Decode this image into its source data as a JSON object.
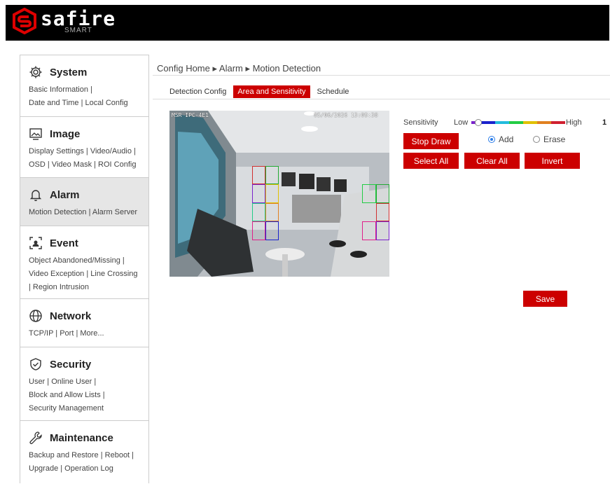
{
  "header": {
    "brand": "safire",
    "brand_sub": "SMART"
  },
  "sidebar": [
    {
      "title": "System",
      "icon": "gear-icon",
      "links": [
        "Basic Information |",
        "Date and Time | Local Config"
      ]
    },
    {
      "title": "Image",
      "icon": "image-icon",
      "links": [
        "Display Settings | Video/Audio |",
        "OSD | Video Mask | ROI Config"
      ]
    },
    {
      "title": "Alarm",
      "icon": "bell-icon",
      "links": [
        "Motion Detection | Alarm Server"
      ],
      "active": true
    },
    {
      "title": "Event",
      "icon": "event-icon",
      "links": [
        "Object Abandoned/Missing |",
        "Video Exception | Line Crossing",
        " | Region Intrusion"
      ]
    },
    {
      "title": "Network",
      "icon": "globe-icon",
      "links": [
        "TCP/IP | Port | More..."
      ]
    },
    {
      "title": "Security",
      "icon": "shield-icon",
      "links": [
        "User | Online User |",
        "Block and Allow Lists |",
        "Security Management"
      ]
    },
    {
      "title": "Maintenance",
      "icon": "wrench-icon",
      "links": [
        "Backup and Restore | Reboot |",
        "Upgrade | Operation Log"
      ]
    }
  ],
  "breadcrumb": "Config Home ▸ Alarm ▸ Motion Detection",
  "tabs": [
    {
      "label": "Detection Config",
      "active": false
    },
    {
      "label": "Area and Sensitivity",
      "active": true
    },
    {
      "label": "Schedule",
      "active": false
    }
  ],
  "video": {
    "osd_left": "MSR IPC-4E1",
    "osd_right": "05/06/2026 13:09:38"
  },
  "sensitivity": {
    "label": "Sensitivity",
    "low": "Low",
    "high": "High",
    "value": "1"
  },
  "buttons": {
    "stop_draw": "Stop Draw",
    "select_all": "Select All",
    "clear_all": "Clear All",
    "invert": "Invert",
    "save": "Save"
  },
  "mode": {
    "add": "Add",
    "erase": "Erase",
    "selected": "add"
  },
  "colors": {
    "accent": "#cc0000"
  }
}
